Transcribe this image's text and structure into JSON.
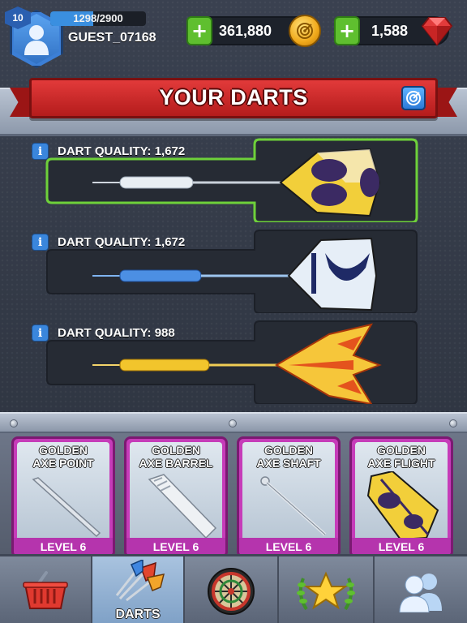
{
  "player": {
    "level": "10",
    "xp_text": "1298/2900",
    "xp_progress": 0.45,
    "username": "GUEST_07168"
  },
  "currency": {
    "coins": "361,880",
    "gems": "1,588"
  },
  "header": {
    "title": "YOUR DARTS"
  },
  "darts": [
    {
      "quality_label": "DART QUALITY: 1,672",
      "selected": true,
      "barrel_color": "#e9eef3",
      "flight_color": "#f2cf3a",
      "flight_accent": "#3b2a63"
    },
    {
      "quality_label": "DART QUALITY: 1,672",
      "selected": false,
      "barrel_color": "#4c8fe3",
      "flight_color": "#e6eef7",
      "flight_accent": "#1f2a66"
    },
    {
      "quality_label": "DART QUALITY: 988",
      "selected": false,
      "barrel_color": "#f2c52c",
      "flight_color": "#f6c63a",
      "flight_accent": "#e4531d"
    }
  ],
  "parts": [
    {
      "title_line1": "GOLDEN",
      "title_line2": "AXE POINT",
      "level": "LEVEL 6",
      "icon": "dart-point-icon"
    },
    {
      "title_line1": "GOLDEN",
      "title_line2": "AXE BARREL",
      "level": "LEVEL 6",
      "icon": "dart-barrel-icon"
    },
    {
      "title_line1": "GOLDEN",
      "title_line2": "AXE SHAFT",
      "level": "LEVEL 6",
      "icon": "dart-shaft-icon"
    },
    {
      "title_line1": "GOLDEN",
      "title_line2": "AXE FLIGHT",
      "level": "LEVEL 6",
      "icon": "dart-flight-icon"
    }
  ],
  "nav": {
    "tabs": [
      {
        "name": "shop",
        "label": "",
        "icon": "basket-icon"
      },
      {
        "name": "darts",
        "label": "DARTS",
        "icon": "darts-icon",
        "active": true
      },
      {
        "name": "play",
        "label": "",
        "icon": "dartboard-icon"
      },
      {
        "name": "achievements",
        "label": "",
        "icon": "star-laurel-icon"
      },
      {
        "name": "friends",
        "label": "",
        "icon": "friends-icon"
      }
    ]
  },
  "colors": {
    "banner_red": "#c42424",
    "card_magenta": "#c63cb9",
    "selected_green": "#6ed13a",
    "plus_green": "#5fbf2f"
  }
}
